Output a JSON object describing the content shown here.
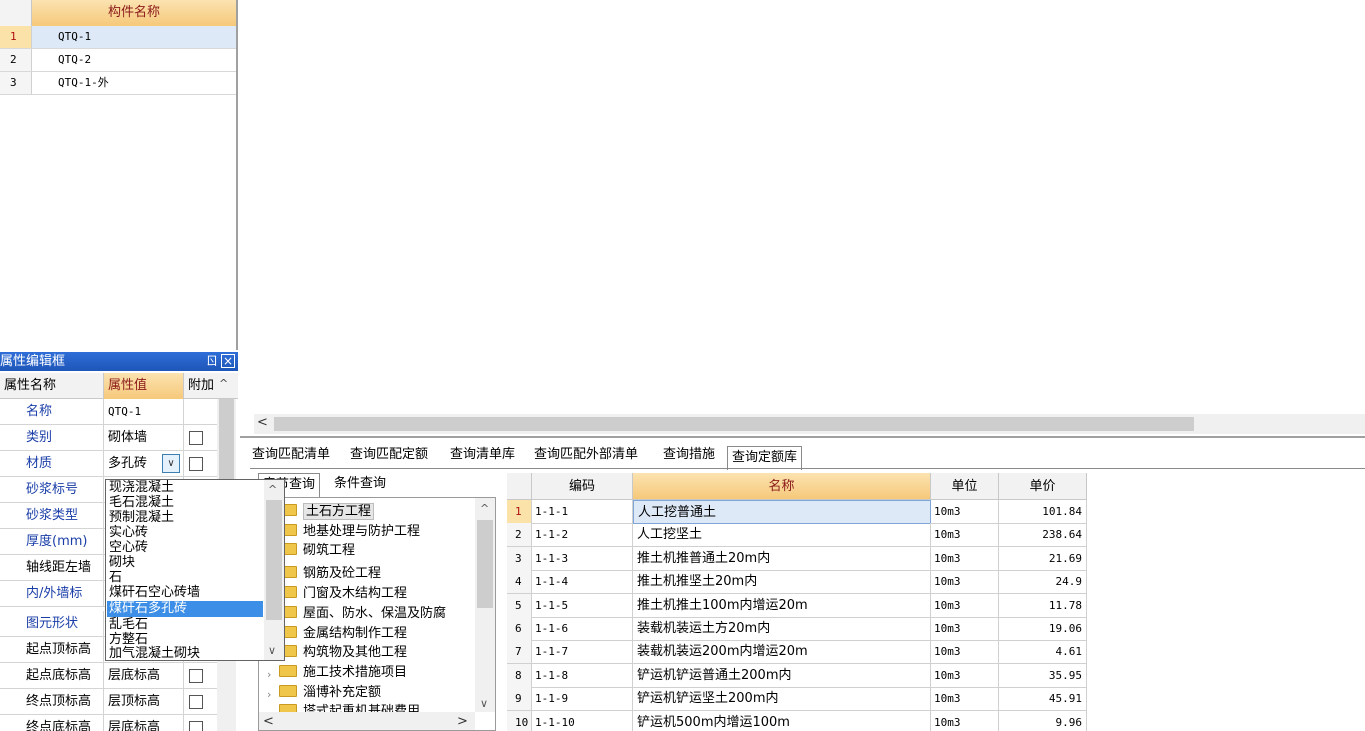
{
  "component_list": {
    "header": "构件名称",
    "rows": [
      {
        "idx": "1",
        "name": "QTQ-1"
      },
      {
        "idx": "2",
        "name": "QTQ-2"
      },
      {
        "idx": "3",
        "name": "QTQ-1-外"
      }
    ]
  },
  "property_editor": {
    "title": "属性编辑框",
    "pin_label": "ㄖ",
    "close_label": "×",
    "headers": {
      "name": "属性名称",
      "value": "属性值",
      "extra": "附加"
    },
    "rows": [
      {
        "name": "名称",
        "value": "QTQ-1"
      },
      {
        "name": "类别",
        "value": "砌体墙"
      },
      {
        "name": "材质",
        "value": "多孔砖"
      },
      {
        "name": "砂浆标号",
        "value": ""
      },
      {
        "name": "砂浆类型",
        "value": ""
      },
      {
        "name": "厚度(mm)",
        "value": ""
      },
      {
        "name": "轴线距左墙",
        "value": ""
      },
      {
        "name": "内/外墙标",
        "value": ""
      },
      {
        "name": "图元形状",
        "value": ""
      },
      {
        "name": "起点顶标高",
        "value": ""
      },
      {
        "name": "起点底标高",
        "value": "层底标高"
      },
      {
        "name": "终点顶标高",
        "value": "层顶标高"
      },
      {
        "name": "终点底标高",
        "value": "层底标高"
      }
    ]
  },
  "material_dropdown": {
    "options": [
      "现浇混凝土",
      "毛石混凝土",
      "预制混凝土",
      "实心砖",
      "空心砖",
      "砌块",
      "石",
      "煤矸石空心砖墙",
      "煤矸石多孔砖",
      "乱毛石",
      "方整石",
      "加气混凝土砌块"
    ],
    "selected": "煤矸石多孔砖"
  },
  "query_tabs": {
    "items": [
      "查询匹配清单",
      "查询匹配定额",
      "查询清单库",
      "查询匹配外部清单",
      "查询措施",
      "查询定额库"
    ],
    "active": "查询定额库"
  },
  "quota_library": {
    "subtabs": [
      "章节查询",
      "条件查询"
    ],
    "active_subtab": "章节查询",
    "tree": [
      {
        "label": "土石方工程",
        "expand": "",
        "selected": true
      },
      {
        "label": "地基处理与防护工程",
        "expand": ""
      },
      {
        "label": "砌筑工程",
        "expand": ""
      },
      {
        "label": "钢筋及砼工程",
        "expand": ""
      },
      {
        "label": "门窗及木结构工程",
        "expand": ""
      },
      {
        "label": "屋面、防水、保温及防腐",
        "expand": ""
      },
      {
        "label": "金属结构制作工程",
        "expand": ""
      },
      {
        "label": "构筑物及其他工程",
        "expand": ""
      },
      {
        "label": "施工技术措施项目",
        "expand": "›"
      },
      {
        "label": "淄博补充定额",
        "expand": "›"
      },
      {
        "label": "塔式起重机基础费用",
        "expand": ""
      }
    ],
    "table": {
      "headers": {
        "idx": "",
        "code": "编码",
        "name": "名称",
        "unit": "单位",
        "price": "单价"
      },
      "rows": [
        {
          "idx": "1",
          "code": "1-1-1",
          "name": "人工挖普通土",
          "unit": "10m3",
          "price": "101.84"
        },
        {
          "idx": "2",
          "code": "1-1-2",
          "name": "人工挖坚土",
          "unit": "10m3",
          "price": "238.64"
        },
        {
          "idx": "3",
          "code": "1-1-3",
          "name": "推土机推普通土20m内",
          "unit": "10m3",
          "price": "21.69"
        },
        {
          "idx": "4",
          "code": "1-1-4",
          "name": "推土机推坚土20m内",
          "unit": "10m3",
          "price": "24.9"
        },
        {
          "idx": "5",
          "code": "1-1-5",
          "name": "推土机推土100m内增运20m",
          "unit": "10m3",
          "price": "11.78"
        },
        {
          "idx": "6",
          "code": "1-1-6",
          "name": "装载机装运土方20m内",
          "unit": "10m3",
          "price": "19.06"
        },
        {
          "idx": "7",
          "code": "1-1-7",
          "name": "装载机装运200m内增运20m",
          "unit": "10m3",
          "price": "4.61"
        },
        {
          "idx": "8",
          "code": "1-1-8",
          "name": "铲运机铲运普通土200m内",
          "unit": "10m3",
          "price": "35.95"
        },
        {
          "idx": "9",
          "code": "1-1-9",
          "name": "铲运机铲运坚土200m内",
          "unit": "10m3",
          "price": "45.91"
        },
        {
          "idx": "10",
          "code": "1-1-10",
          "name": "铲运机500m内增运100m",
          "unit": "10m3",
          "price": "9.96"
        }
      ]
    }
  },
  "colors": {
    "accent_header": "#f6c97a",
    "selection": "#3c8ee6",
    "titlebar": "#1e56b8"
  }
}
